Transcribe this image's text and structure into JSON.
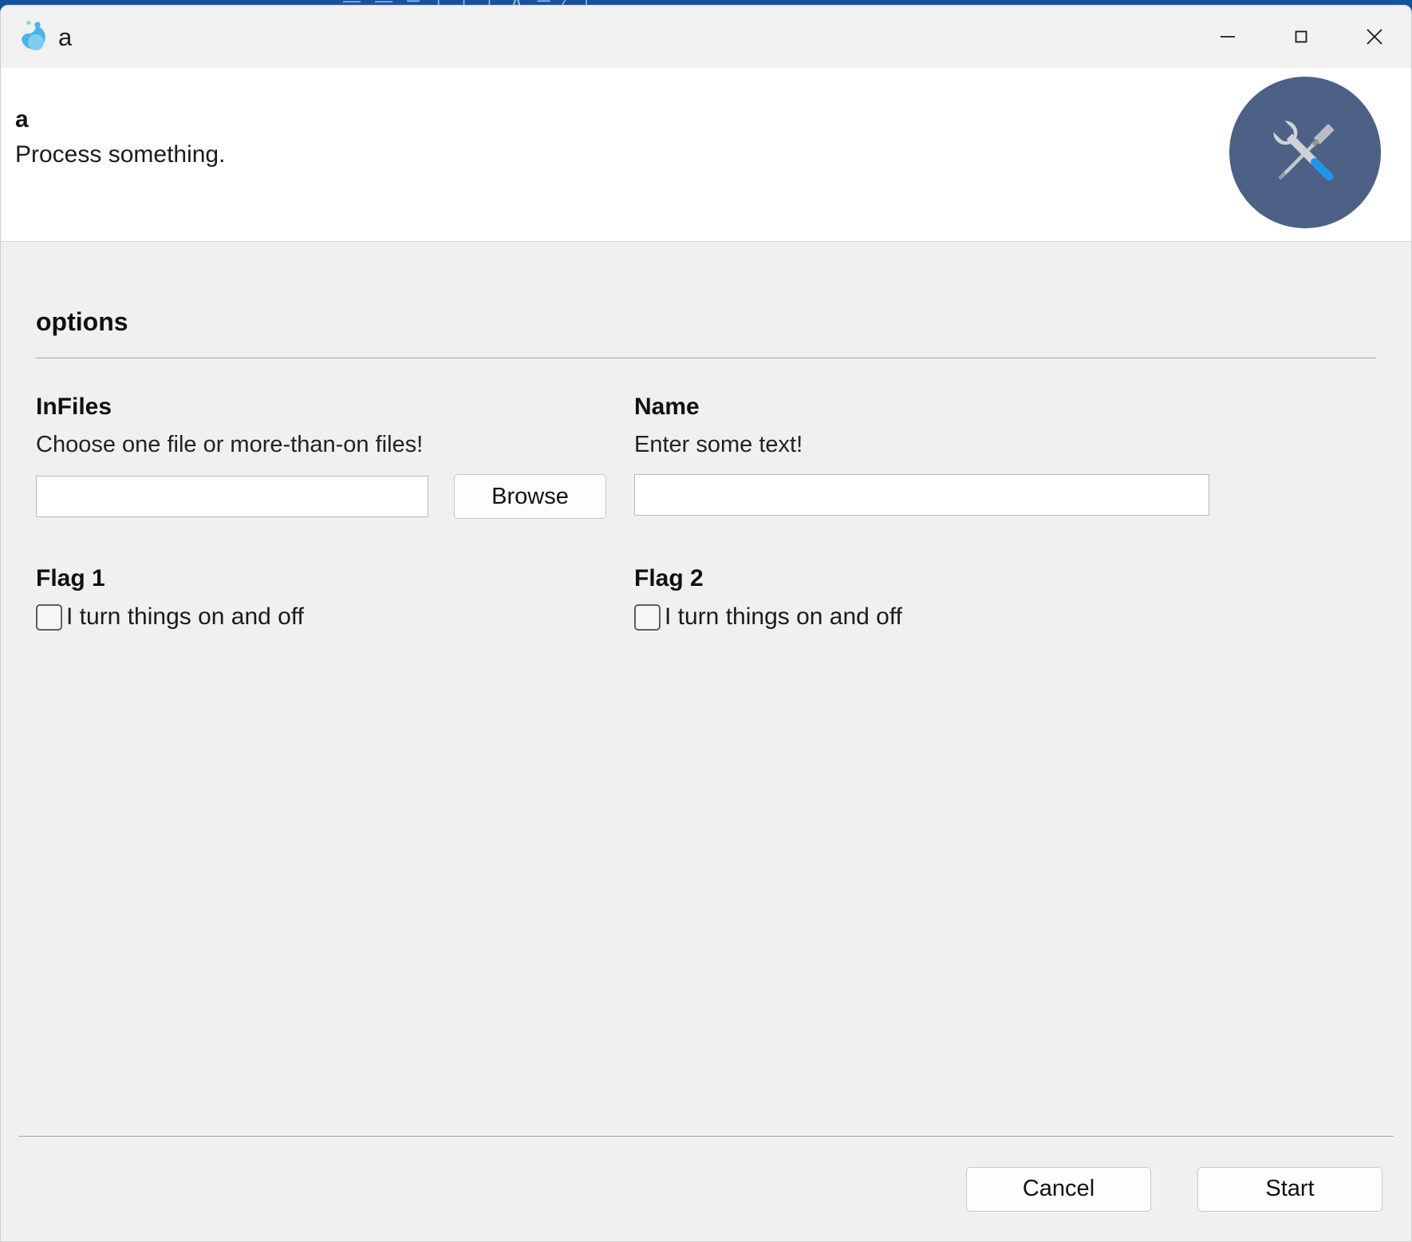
{
  "background_window": {
    "title_fragment": "—  —  ─ │ │ │ ∧ ─ ∕ │"
  },
  "titlebar": {
    "icon": "water-drop-icon",
    "title": "a",
    "minimize_label": "─",
    "maximize_label": "□",
    "close_label": "✕"
  },
  "header": {
    "title": "a",
    "subtitle": "Process something.",
    "icon": "tools-icon",
    "icon_circle_color": "#4d6186"
  },
  "main": {
    "section_title": "options",
    "fields": {
      "infiles": {
        "label": "InFiles",
        "help": "Choose one file or more-than-on files!",
        "value": "",
        "placeholder": "",
        "browse_label": "Browse"
      },
      "name": {
        "label": "Name",
        "help": "Enter some text!",
        "value": "",
        "placeholder": ""
      },
      "flag1": {
        "label": "Flag 1",
        "checkbox_label": "I turn things on and off",
        "checked": false
      },
      "flag2": {
        "label": "Flag 2",
        "checkbox_label": "I turn things on and off",
        "checked": false
      }
    }
  },
  "footer": {
    "cancel_label": "Cancel",
    "start_label": "Start"
  }
}
